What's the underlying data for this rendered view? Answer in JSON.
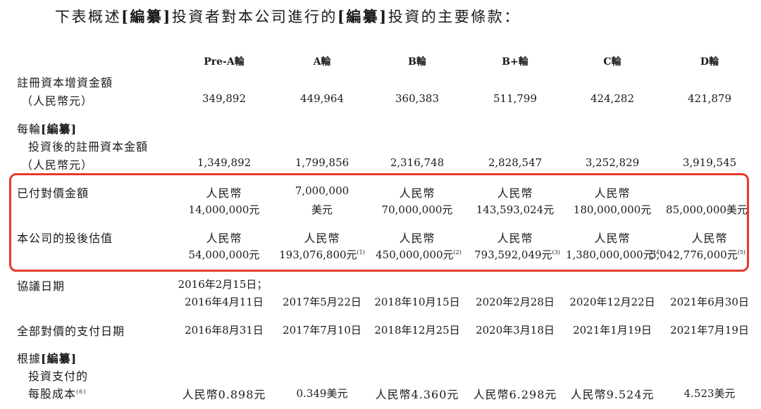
{
  "intro": {
    "part1": "下表概述",
    "redacted1": "[編纂]",
    "part2": "投資者對本公司進行的",
    "redacted2": "[編纂]",
    "part3": "投資的主要條款："
  },
  "columns": [
    "Pre-A輪",
    "A輪",
    "B輪",
    "B+輪",
    "C輪",
    "D輪"
  ],
  "rows": {
    "registered_capital_increase": {
      "label_line1": "註冊資本增資金額",
      "label_line2": "（人民幣元）",
      "values": [
        "349,892",
        "449,964",
        "360,383",
        "511,799",
        "424,282",
        "421,879"
      ]
    },
    "post_investment_capital": {
      "label_line1_a": "每輪",
      "label_line1_b": "[編纂]",
      "label_line2": "投資後的註冊資本金額",
      "label_line3": "（人民幣元）",
      "values": [
        "1,349,892",
        "1,799,856",
        "2,316,748",
        "2,828,547",
        "3,252,829",
        "3,919,545"
      ]
    },
    "consideration_paid": {
      "label": "已付對價金額",
      "line1": [
        "人民幣",
        "7,000,000",
        "人民幣",
        "人民幣",
        "人民幣",
        ""
      ],
      "line2": [
        "14,000,000元",
        "美元",
        "70,000,000元",
        "143,593,024元",
        "180,000,000元",
        "85,000,000美元"
      ]
    },
    "post_money_valuation": {
      "label": "本公司的投後估值",
      "line1": [
        "人民幣",
        "人民幣",
        "人民幣",
        "人民幣",
        "人民幣",
        "人民幣"
      ],
      "line2": [
        "54,000,000元",
        "193,076,800元",
        "450,000,000元",
        "793,592,049元",
        "1,380,000,000元",
        "5,042,776,000元"
      ],
      "notes": [
        "",
        "(1)",
        "(2)",
        "(3)",
        "(4)",
        "(5)"
      ]
    },
    "agreement_date": {
      "label": "協議日期",
      "line1": [
        "2016年2月15日；",
        "",
        "",
        "",
        "",
        ""
      ],
      "line2": [
        "2016年4月11日",
        "2017年5月22日",
        "2018年10月15日",
        "2020年2月28日",
        "2020年12月22日",
        "2021年6月30日"
      ]
    },
    "payment_date": {
      "label": "全部對價的支付日期",
      "values": [
        "2016年8月31日",
        "2017年7月10日",
        "2018年12月25日",
        "2020年3月18日",
        "2021年1月19日",
        "2021年7月19日"
      ]
    },
    "cost_per_share": {
      "label_line1_a": "根據",
      "label_line1_b": "[編纂]",
      "label_line2": "投資支付的",
      "label_line3": "每股成本",
      "label_note": "(6)",
      "values": [
        "人民幣0.898元",
        "0.349美元",
        "人民幣4.360元",
        "人民幣6.298元",
        "人民幣9.524元",
        "4.523美元"
      ]
    }
  },
  "colors": {
    "highlight_border": "#e8392b",
    "text": "#1a1a1a"
  }
}
